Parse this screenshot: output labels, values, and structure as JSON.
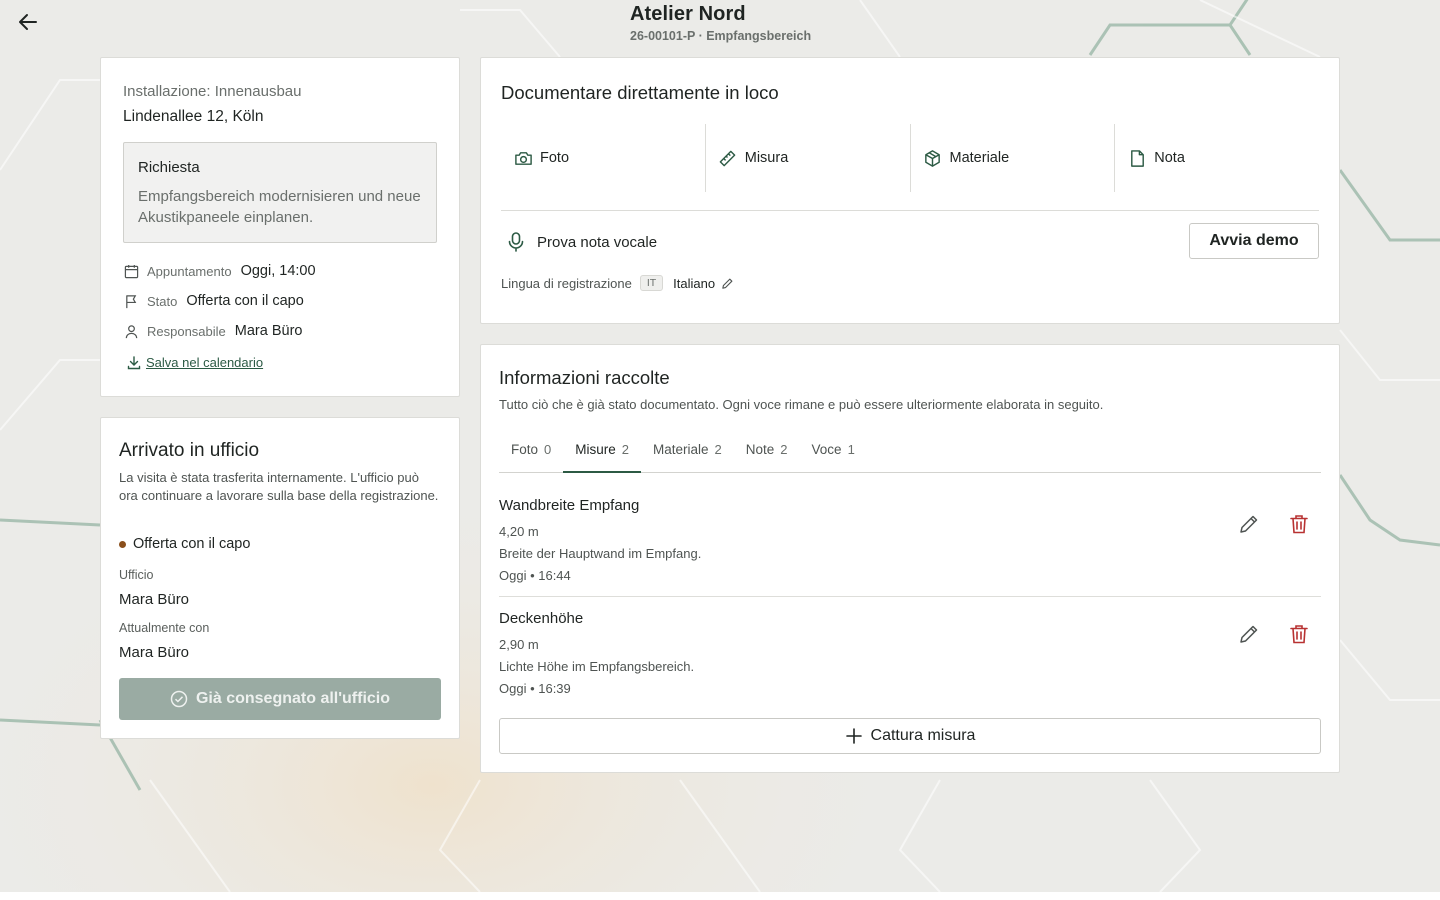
{
  "header": {
    "title": "Atelier Nord",
    "subtitle": "26-00101-P · Empfangsbereich"
  },
  "info": {
    "label": "Installazione: Innenausbau",
    "address": "Lindenallee 12, Köln",
    "request_title": "Richiesta",
    "request_text": "Empfangsbereich modernisieren und neue Akustikpaneele einplanen.",
    "appointment_key": "Appuntamento",
    "appointment_val": "Oggi, 14:00",
    "status_key": "Stato",
    "status_val": "Offerta con il capo",
    "owner_key": "Responsabile",
    "owner_val": "Mara Büro",
    "calendar_link": "Salva nel calendario"
  },
  "office": {
    "title": "Arrivato in ufficio",
    "description": "La visita è stata trasferita internamente. L'ufficio può ora continuare a lavorare sulla base della registrazione.",
    "status": "Offerta con il capo",
    "office_key": "Ufficio",
    "office_val": "Mara Büro",
    "current_key": "Attualmente con",
    "current_val": "Mara Büro",
    "button": "Già consegnato all'ufficio"
  },
  "documentation": {
    "title": "Documentare direttamente in loco",
    "tiles": [
      {
        "label": "Foto",
        "icon": "camera-icon"
      },
      {
        "label": "Misura",
        "icon": "ruler-icon"
      },
      {
        "label": "Materiale",
        "icon": "package-icon"
      },
      {
        "label": "Nota",
        "icon": "note-icon"
      }
    ],
    "voice_label": "Prova nota vocale",
    "demo_button": "Avvia demo",
    "lang_label": "Lingua di registrazione",
    "lang_code": "IT",
    "lang_name": "Italiano"
  },
  "collected": {
    "title": "Informazioni raccolte",
    "subtitle": "Tutto ciò che è già stato documentato. Ogni voce rimane e può essere ulteriormente elaborata in seguito.",
    "tabs": [
      {
        "label": "Foto",
        "count": "0"
      },
      {
        "label": "Misure",
        "count": "2"
      },
      {
        "label": "Materiale",
        "count": "2"
      },
      {
        "label": "Note",
        "count": "2"
      },
      {
        "label": "Voce",
        "count": "1"
      }
    ],
    "active_tab": "Misure",
    "entries": [
      {
        "title": "Wandbreite Empfang",
        "value": "4,20 m",
        "description": "Breite der Hauptwand im Empfang.",
        "time": "Oggi • 16:44"
      },
      {
        "title": "Deckenhöhe",
        "value": "2,90 m",
        "description": "Lichte Höhe im Empfangsbereich.",
        "time": "Oggi • 16:39"
      }
    ],
    "capture_button": "Cattura misura"
  },
  "colors": {
    "accent": "#2c5a44",
    "danger": "#b83232",
    "status_dot": "#8a4f1c",
    "disabled_button": "#9aaba3"
  }
}
